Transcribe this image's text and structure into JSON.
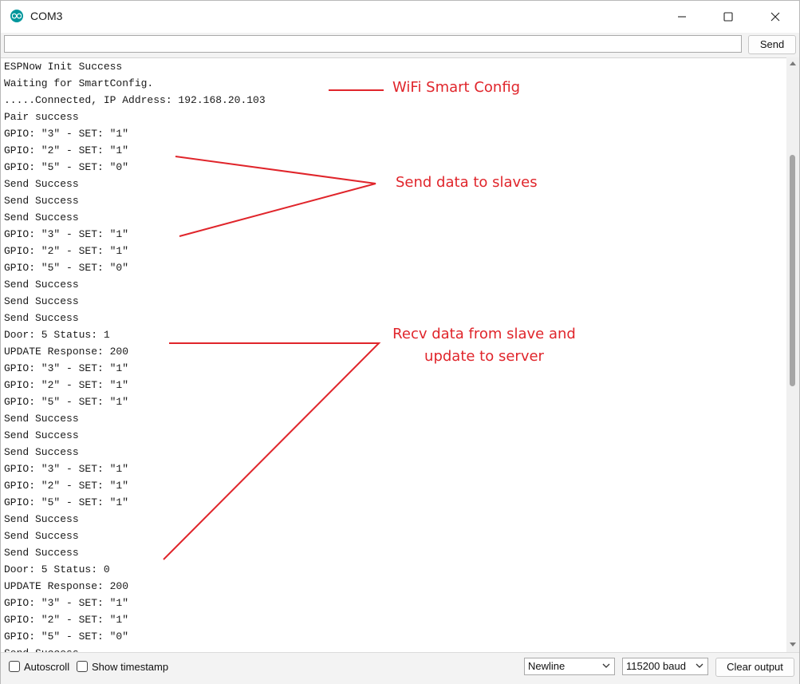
{
  "window": {
    "title": "COM3"
  },
  "send_bar": {
    "input_value": "",
    "send_label": "Send"
  },
  "output_lines": [
    "ESPNow Init Success",
    "Waiting for SmartConfig.",
    ".....Connected, IP Address: 192.168.20.103",
    "Pair success",
    "GPIO: \"3\" - SET: \"1\"",
    "GPIO: \"2\" - SET: \"1\"",
    "GPIO: \"5\" - SET: \"0\"",
    "Send Success",
    "Send Success",
    "Send Success",
    "GPIO: \"3\" - SET: \"1\"",
    "GPIO: \"2\" - SET: \"1\"",
    "GPIO: \"5\" - SET: \"0\"",
    "Send Success",
    "Send Success",
    "Send Success",
    "Door: 5 Status: 1",
    "UPDATE Response: 200",
    "GPIO: \"3\" - SET: \"1\"",
    "GPIO: \"2\" - SET: \"1\"",
    "GPIO: \"5\" - SET: \"1\"",
    "Send Success",
    "Send Success",
    "Send Success",
    "GPIO: \"3\" - SET: \"1\"",
    "GPIO: \"2\" - SET: \"1\"",
    "GPIO: \"5\" - SET: \"1\"",
    "Send Success",
    "Send Success",
    "Send Success",
    "Door: 5 Status: 0",
    "UPDATE Response: 200",
    "GPIO: \"3\" - SET: \"1\"",
    "GPIO: \"2\" - SET: \"1\"",
    "GPIO: \"5\" - SET: \"0\"",
    "Send Success"
  ],
  "annotations": {
    "wifi_smart_config": "WiFi Smart Config",
    "send_data_to_slaves": "Send data to slaves",
    "recv_line1": "Recv data from slave and",
    "recv_line2": "update to server",
    "color": "#e0252b"
  },
  "bottom_bar": {
    "autoscroll_label": "Autoscroll",
    "autoscroll_checked": false,
    "timestamp_label": "Show timestamp",
    "timestamp_checked": false,
    "line_ending_value": "Newline",
    "baud_value": "115200 baud",
    "clear_label": "Clear output"
  },
  "icons": {
    "app": "arduino-icon",
    "minimize": "minimize-icon",
    "maximize": "maximize-icon",
    "close": "close-icon"
  },
  "colors": {
    "accent": "#00979c"
  }
}
